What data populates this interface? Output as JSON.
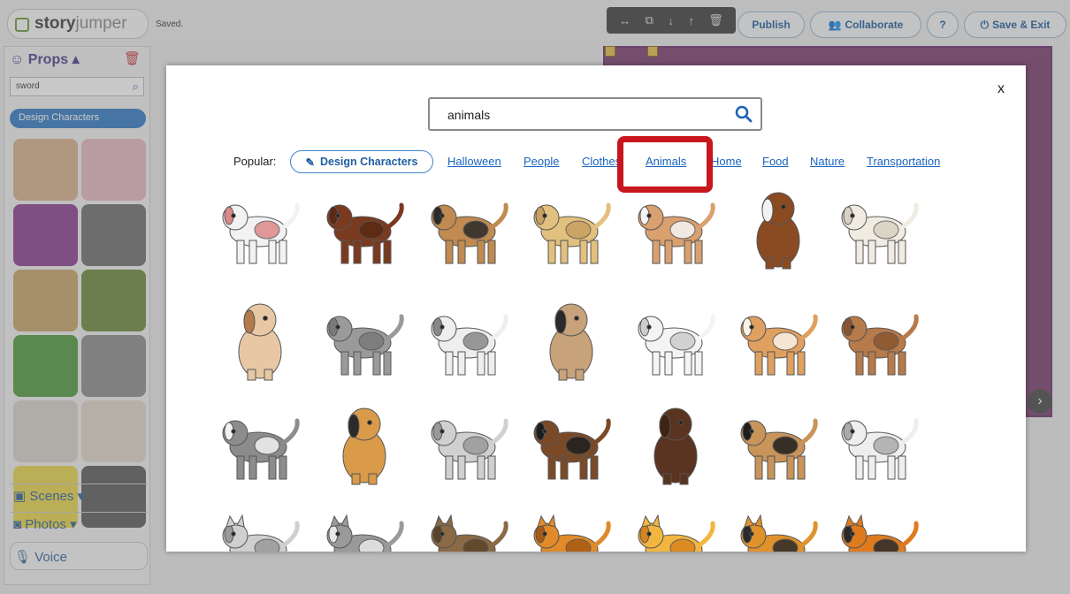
{
  "app": {
    "logo_bold": "story",
    "logo_thin": "jumper",
    "saved_status": "Saved.",
    "toolbar_icons": [
      "resize-icon",
      "copy-icon",
      "move-down-icon",
      "move-up-icon",
      "delete-icon"
    ],
    "buttons": {
      "publish": "Publish",
      "collaborate": "Collaborate",
      "help": "?",
      "save_exit": "Save & Exit"
    }
  },
  "sidebar": {
    "section_title": "Props",
    "search_value": "sword",
    "design_characters": "Design Characters",
    "sections": [
      "Scenes",
      "Photos",
      "Voice"
    ]
  },
  "modal": {
    "close_label": "x",
    "search_value": "animals",
    "popular_label": "Popular:",
    "design_chip": "Design Characters",
    "categories": [
      "Halloween",
      "People",
      "Clothes",
      "Animals",
      "Home",
      "Food",
      "Nature",
      "Transportation"
    ],
    "highlighted_category": "Animals",
    "accent_color": "#1a63c1",
    "highlight_color": "#c8161d",
    "results": [
      [
        "bulldog-white",
        "brown-shaggy-dog",
        "beagle",
        "yellow-labrador",
        "english-bulldog",
        "cartoon-brown-dog-with-bone",
        "fluffy-white-spitz"
      ],
      [
        "puppy-sitting",
        "gray-wolf-dog",
        "small-white-dog",
        "pug",
        "white-poodle",
        "corgi",
        "cocker-spaniel"
      ],
      [
        "husky",
        "beagle-sitting",
        "small-gray-dog",
        "basset-hound",
        "brown-dog-sitting",
        "beagle-standing",
        "small-white-terrier"
      ],
      [
        "gray-cartoon-cat",
        "gray-kitten",
        "brown-cat-lying",
        "orange-tabby-cat",
        "lion",
        "tiger-cub",
        "tiger"
      ]
    ]
  }
}
